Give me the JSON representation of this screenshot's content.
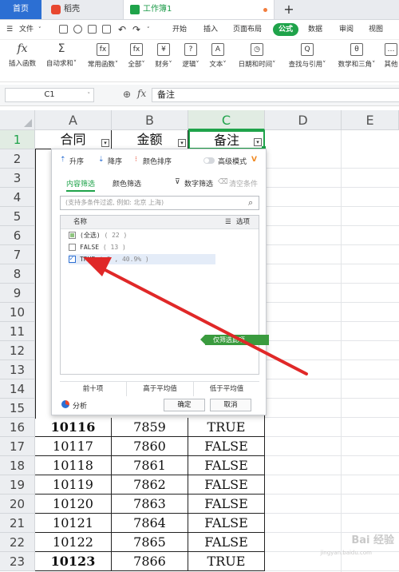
{
  "tabs": {
    "home": "首页",
    "doc": "稻壳",
    "book": "工作簿1",
    "plus": "+"
  },
  "menu": {
    "file": "文件",
    "items": [
      "开始",
      "插入",
      "页面布局",
      "公式",
      "数据",
      "审阅",
      "视图"
    ],
    "active": "公式"
  },
  "ribbon": [
    {
      "label": "插入函数",
      "icon": "fx"
    },
    {
      "label": "自动求和˅",
      "icon": "Σ"
    },
    {
      "label": "常用函数˅",
      "icon": "fx"
    },
    {
      "label": "全部˅",
      "icon": "fx"
    },
    {
      "label": "财务˅",
      "icon": "¥"
    },
    {
      "label": "逻辑˅",
      "icon": "?"
    },
    {
      "label": "文本˅",
      "icon": "A"
    },
    {
      "label": "日期和时间˅",
      "icon": "◷"
    },
    {
      "label": "查找与引用˅",
      "icon": "Q"
    },
    {
      "label": "数学和三角˅",
      "icon": "θ"
    },
    {
      "label": "其他",
      "icon": "…"
    }
  ],
  "formula_bar": {
    "cell_ref": "C1",
    "fx": "fx",
    "value": "备注"
  },
  "columns": [
    "A",
    "B",
    "C",
    "D",
    "E"
  ],
  "rows": [
    "1",
    "2",
    "3",
    "4",
    "5",
    "6",
    "7",
    "8",
    "9",
    "10",
    "11",
    "12",
    "13",
    "14",
    "15",
    "16",
    "17",
    "18",
    "19",
    "20",
    "21",
    "22",
    "23"
  ],
  "header_cells": [
    "合同",
    "金额",
    "备注"
  ],
  "data_rows": [
    {
      "row": "16",
      "a": "10116",
      "b": "7859",
      "c": "TRUE"
    },
    {
      "row": "17",
      "a": "10117",
      "b": "7860",
      "c": "FALSE"
    },
    {
      "row": "18",
      "a": "10118",
      "b": "7861",
      "c": "FALSE"
    },
    {
      "row": "19",
      "a": "10119",
      "b": "7862",
      "c": "FALSE"
    },
    {
      "row": "20",
      "a": "10120",
      "b": "7863",
      "c": "FALSE"
    },
    {
      "row": "21",
      "a": "10121",
      "b": "7864",
      "c": "FALSE"
    },
    {
      "row": "22",
      "a": "10122",
      "b": "7865",
      "c": "FALSE"
    },
    {
      "row": "23",
      "a": "10123",
      "b": "7866",
      "c": "TRUE"
    }
  ],
  "filter_panel": {
    "asc": "升序",
    "desc": "降序",
    "color_sort": "颜色排序",
    "advanced": "高级模式",
    "tab_content": "内容筛选",
    "tab_color": "颜色筛选",
    "number_filter": "数字筛选",
    "clear": "清空条件",
    "search_placeholder": "(支持多条件过滤, 例如: 北京 上海)",
    "list_header": "名称",
    "options": "选项",
    "items": [
      {
        "label": "(全选)",
        "count": "( 22 )",
        "state": "partial"
      },
      {
        "label": "FALSE",
        "count": "( 13 )",
        "state": "unchecked"
      },
      {
        "label": "TRUE",
        "count": "( 9 , 40.9% )",
        "state": "checked"
      }
    ],
    "only_this": "仅筛选此项",
    "quick": [
      "前十项",
      "高于平均值",
      "低于平均值"
    ],
    "analysis": "分析",
    "ok": "确定",
    "cancel": "取消"
  },
  "watermark": {
    "text": "Bai 经验",
    "sub": "jingyan.baidu.com"
  },
  "colors": {
    "accent_green": "#1fa34a",
    "tab_blue": "#2c6fd3",
    "arrow_red": "#e02828"
  }
}
